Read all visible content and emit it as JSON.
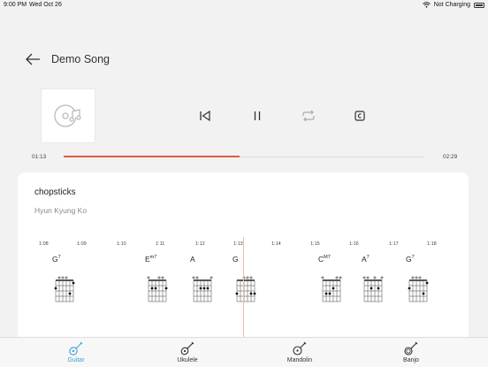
{
  "status_bar": {
    "time": "9:00 PM",
    "date": "Wed Oct 26",
    "charging": "Not Charging"
  },
  "header": {
    "title": "Demo Song"
  },
  "player": {
    "elapsed": "01:13",
    "duration": "02:29",
    "progress": 0.487
  },
  "song": {
    "name": "chopsticks",
    "artist": "Hyun Kyung Ko"
  },
  "timeline": [
    "1:08",
    "1:09",
    "1:10",
    "1:11",
    "1:12",
    "1:13",
    "1:14",
    "1:15",
    "1:16",
    "1:17",
    "1:18"
  ],
  "chords": [
    {
      "root": "G",
      "ext": "7"
    },
    {
      "root": "E",
      "ext": "m7"
    },
    {
      "root": "A",
      "ext": ""
    },
    {
      "root": "G",
      "ext": ""
    },
    {
      "root": "C",
      "ext": "M7"
    },
    {
      "root": "A",
      "ext": "7"
    },
    {
      "root": "G",
      "ext": "7"
    }
  ],
  "tabs": [
    {
      "label": "Guitar",
      "icon": "guitar-icon",
      "active": true
    },
    {
      "label": "Ukulele",
      "icon": "ukulele-icon",
      "active": false
    },
    {
      "label": "Mandolin",
      "icon": "mandolin-icon",
      "active": false
    },
    {
      "label": "Banjo",
      "icon": "banjo-icon",
      "active": false
    }
  ],
  "colors": {
    "accent": "#e05a45",
    "tab_active": "#3aa3d8"
  }
}
